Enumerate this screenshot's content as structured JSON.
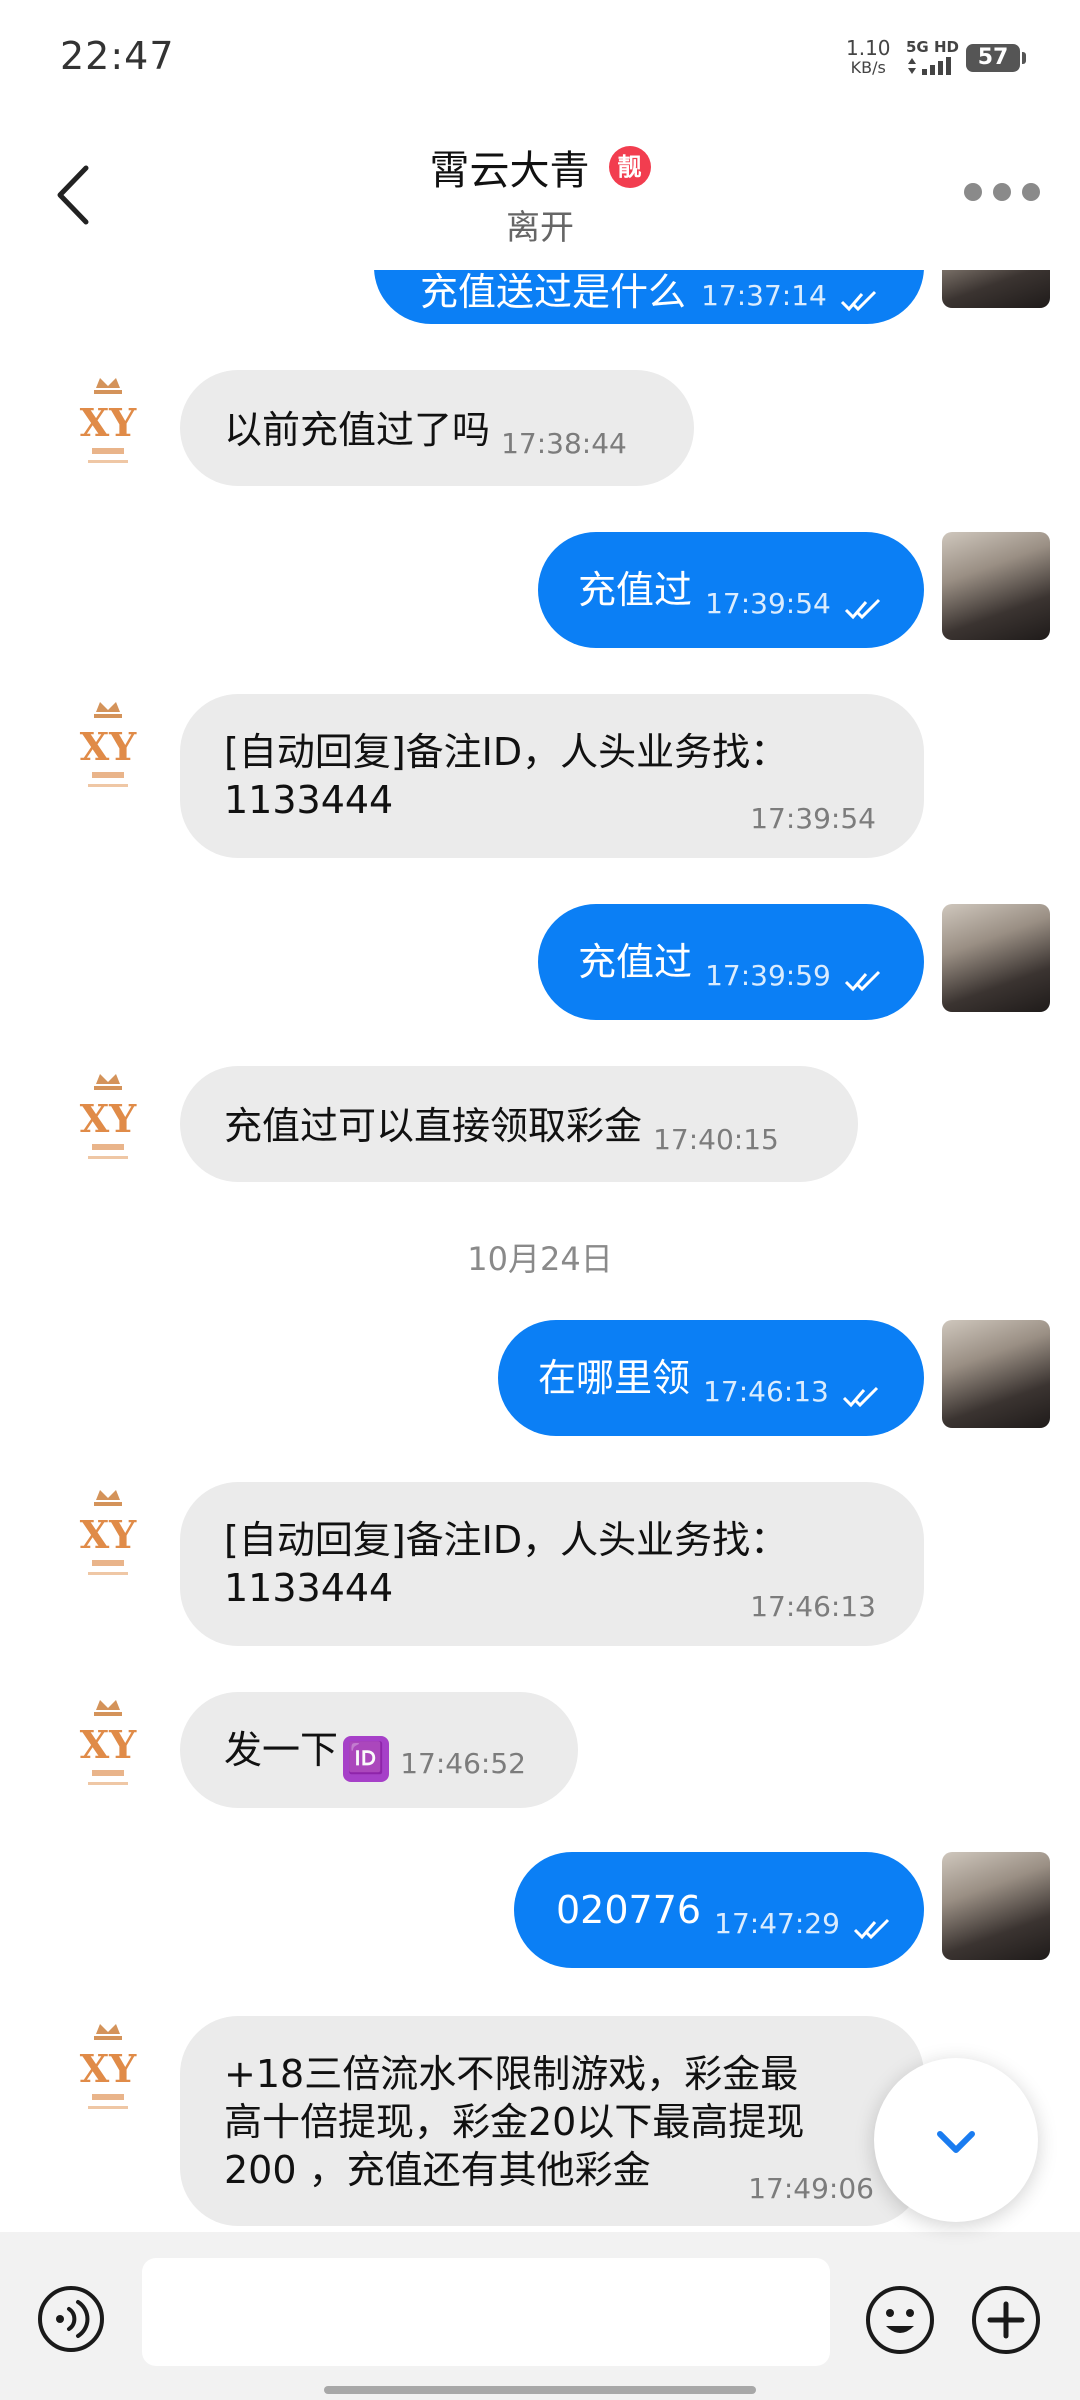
{
  "status_bar": {
    "time": "22:47",
    "speed_value": "1.10",
    "speed_unit": "KB/s",
    "network": "5G HD",
    "battery": "57"
  },
  "header": {
    "title": "霄云大青",
    "badge": "靓",
    "subtitle": "离开"
  },
  "colors": {
    "outgoing_bubble": "#0b7ff5",
    "incoming_bubble": "#ebebeb",
    "badge": "#f23d4f",
    "accent": "#1a7cf0"
  },
  "messages": [
    {
      "direction": "out",
      "text": "充值送过是什么",
      "time": "17:37:14"
    },
    {
      "direction": "in",
      "text": "以前充值过了吗",
      "time": "17:38:44"
    },
    {
      "direction": "out",
      "text": "充值过",
      "time": "17:39:54"
    },
    {
      "direction": "in",
      "text_line1": "[自动回复]备注ID，人头业务找：",
      "text_line2": "1133444",
      "time": "17:39:54"
    },
    {
      "direction": "out",
      "text": "充值过",
      "time": "17:39:59"
    },
    {
      "direction": "in",
      "text": "充值过可以直接领取彩金",
      "time": "17:40:15"
    },
    {
      "direction": "out",
      "text": "在哪里领",
      "time": "17:46:13"
    },
    {
      "direction": "in",
      "text_line1": "[自动回复]备注ID，人头业务找：",
      "text_line2": "1133444",
      "time": "17:46:13"
    },
    {
      "direction": "in",
      "text": "发一下",
      "emoji": "🆔",
      "time": "17:46:52"
    },
    {
      "direction": "out",
      "text": "020776",
      "time": "17:47:29"
    },
    {
      "direction": "in",
      "text_line1": "+18三倍流水不限制游戏，彩金最",
      "text_line2": "高十倍提现，彩金20以下最高提现",
      "text_line3": "200 ，充值还有其他彩金",
      "time": "17:49:06"
    }
  ],
  "date_separator": "10月24日",
  "input": {
    "placeholder": "",
    "value": ""
  },
  "icons": {
    "back": "chevron-left-icon",
    "more": "more-dots-icon",
    "voice": "voice-icon",
    "emoji": "smiley-icon",
    "plus": "plus-icon",
    "scroll": "chevron-down-icon"
  }
}
